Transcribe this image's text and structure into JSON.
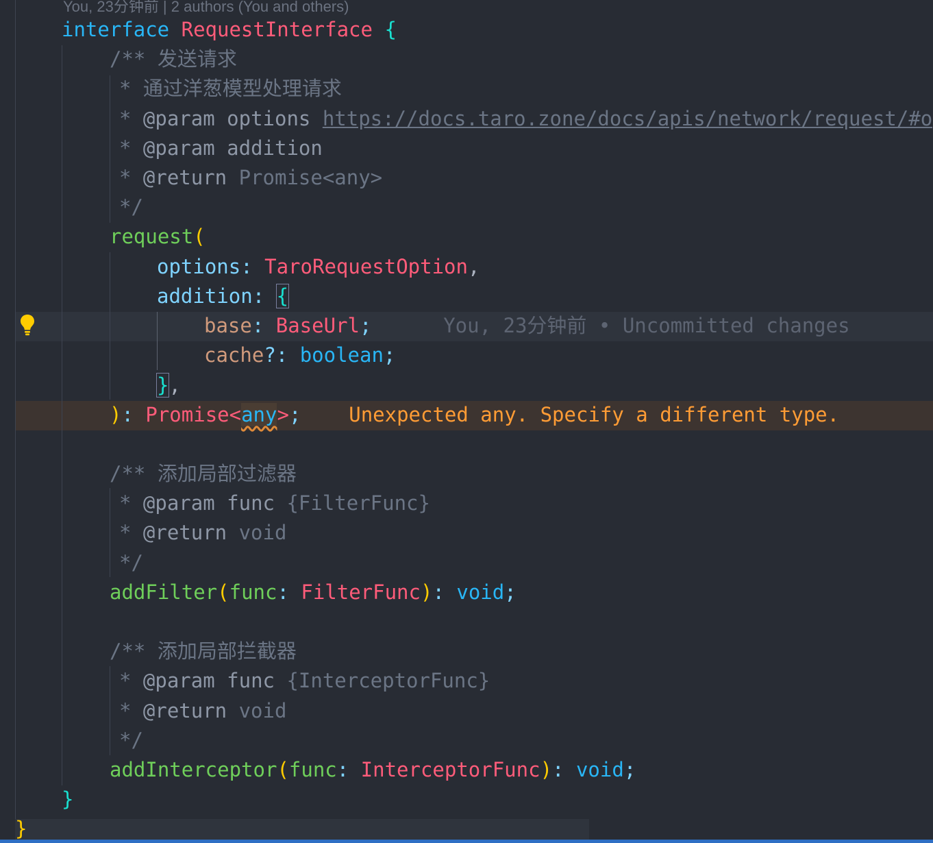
{
  "codelens": "You, 23分钟前 | 2 authors (You and others)",
  "lines": {
    "l1": {
      "kw": "interface",
      "name": "RequestInterface",
      "brace": "{"
    },
    "l2": {
      "text": "/** 发送请求"
    },
    "l3": {
      "text": "* 通过洋葱模型处理请求"
    },
    "l4": {
      "star": "* ",
      "tag": "@param",
      "word": " options ",
      "url": "https://docs.taro.zone/docs/apis/network/request/#op"
    },
    "l5": {
      "star": "* ",
      "tag": "@param",
      "word": " addition"
    },
    "l6": {
      "star": "* ",
      "tag": "@return",
      "type": " Promise<any>"
    },
    "l7": {
      "text": "*/"
    },
    "l8": {
      "fn": "request",
      "paren": "("
    },
    "l9": {
      "name": "options",
      "colon": ": ",
      "type": "TaroRequestOption",
      "comma": ","
    },
    "l10": {
      "name": "addition",
      "colon": ": ",
      "brace": "{"
    },
    "l11": {
      "name": "base",
      "colon": ": ",
      "type": "BaseUrl",
      "semi": ";",
      "blame": "You, 23分钟前 • Uncommitted changes"
    },
    "l12": {
      "name": "cache",
      "q": "?",
      "colon": ": ",
      "type": "boolean",
      "semi": ";"
    },
    "l13": {
      "brace": "}",
      "comma": ","
    },
    "l14": {
      "paren": ")",
      "colon": ": ",
      "type": "Promise",
      "lt": "<",
      "any": "any",
      "gt": ">",
      "semi": ";",
      "error": "Unexpected any. Specify a different type."
    },
    "l16": {
      "text": "/** 添加局部过滤器"
    },
    "l17": {
      "star": "* ",
      "tag": "@param",
      "word": " func ",
      "type": "{FilterFunc}"
    },
    "l18": {
      "star": "* ",
      "tag": "@return",
      "type": " void"
    },
    "l19": {
      "text": "*/"
    },
    "l20": {
      "fn": "addFilter",
      "open": "(",
      "arg": "func",
      "colon": ": ",
      "type": "FilterFunc",
      "close": ")",
      "colon2": ": ",
      "ret": "void",
      "semi": ";"
    },
    "l22": {
      "text": "/** 添加局部拦截器"
    },
    "l23": {
      "star": "* ",
      "tag": "@param",
      "word": " func ",
      "type": "{InterceptorFunc}"
    },
    "l24": {
      "star": "* ",
      "tag": "@return",
      "type": " void"
    },
    "l25": {
      "text": "*/"
    },
    "l26": {
      "fn": "addInterceptor",
      "open": "(",
      "arg": "func",
      "colon": ": ",
      "type": "InterceptorFunc",
      "close": ")",
      "colon2": ": ",
      "ret": "void",
      "semi": ";"
    },
    "l27": {
      "brace": "}"
    },
    "l28": {
      "brace": "}"
    }
  },
  "icons": {
    "lightbulb": "lightbulb-icon"
  },
  "colors": {
    "background": "#282c34",
    "error": "#ff9c35",
    "keyword": "#29b6f6",
    "type": "#ff5c7a",
    "function": "#6fcf5a"
  }
}
